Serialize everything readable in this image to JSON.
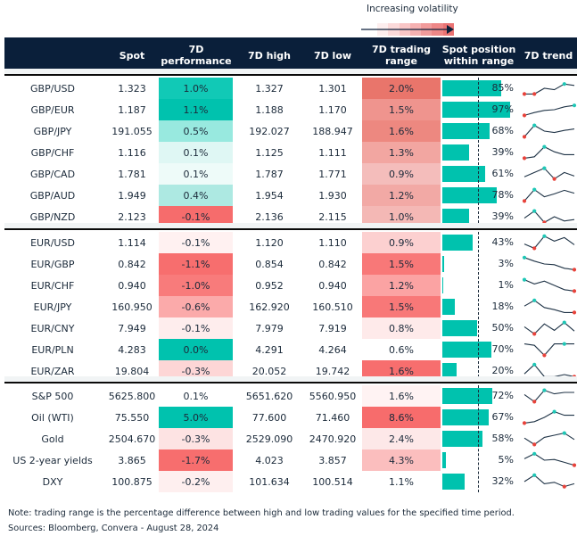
{
  "legend": {
    "label": "Increasing volatility",
    "gradient": [
      "#fdeeee",
      "#fbdada",
      "#f9c6c6",
      "#f5b1b1",
      "#f19b9b",
      "#ee8787",
      "#ea7373"
    ],
    "arrow_color": "#0a1f3a"
  },
  "colors": {
    "header_bg": "#0a1f3a",
    "position_bar": "#00c2ae",
    "trend_line": "#1f3346",
    "trend_high": "#1fc7b6",
    "trend_low": "#e8423a",
    "band": "#f1f4f5"
  },
  "headers": {
    "spot": "Spot",
    "perf": "7D performance",
    "high": "7D high",
    "low": "7D low",
    "range": "7D trading range",
    "position": "Spot position within range",
    "trend": "7D trend"
  },
  "groups": [
    {
      "rows": [
        {
          "name": "GBP/USD",
          "spot": "1.323",
          "perf": "1.0%",
          "high": "1.327",
          "low": "1.301",
          "range": "2.0%",
          "pos": "85%",
          "perf_color": "#11c9b6",
          "range_color": "#e9756b",
          "pos_val": 85,
          "trend": [
            0.1,
            0.1,
            0.5,
            0.4,
            0.8,
            0.7
          ],
          "hi": 4,
          "lo": [
            0,
            1
          ]
        },
        {
          "name": "GBP/EUR",
          "spot": "1.187",
          "perf": "1.1%",
          "high": "1.188",
          "low": "1.170",
          "range": "1.5%",
          "pos": "97%",
          "perf_color": "#00c2ae",
          "range_color": "#ef948e",
          "pos_val": 97,
          "trend": [
            0.1,
            0.3,
            0.45,
            0.5,
            0.7,
            0.8
          ],
          "hi": 5,
          "lo": [
            0
          ]
        },
        {
          "name": "GBP/JPY",
          "spot": "191.055",
          "perf": "0.5%",
          "high": "192.027",
          "low": "188.947",
          "range": "1.6%",
          "pos": "68%",
          "perf_color": "#98e9df",
          "range_color": "#ed8880",
          "pos_val": 68,
          "trend": [
            0.1,
            0.9,
            0.5,
            0.4,
            0.55,
            0.65
          ],
          "hi": 1,
          "lo": [
            0
          ]
        },
        {
          "name": "GBP/CHF",
          "spot": "1.116",
          "perf": "0.1%",
          "high": "1.125",
          "low": "1.111",
          "range": "1.3%",
          "pos": "39%",
          "perf_color": "#dff7f4",
          "range_color": "#f2a6a1",
          "pos_val": 39,
          "trend": [
            0.1,
            0.2,
            0.9,
            0.55,
            0.35,
            0.35
          ],
          "hi": 2,
          "lo": [
            0
          ]
        },
        {
          "name": "GBP/CAD",
          "spot": "1.781",
          "perf": "0.1%",
          "high": "1.787",
          "low": "1.771",
          "range": "0.9%",
          "pos": "61%",
          "perf_color": "#eefbf9",
          "range_color": "#f4bdbb",
          "pos_val": 61,
          "trend": [
            0.3,
            0.6,
            0.9,
            0.15,
            0.6,
            0.35
          ],
          "hi": 2,
          "lo": [
            3
          ]
        },
        {
          "name": "GBP/AUD",
          "spot": "1.949",
          "perf": "0.4%",
          "high": "1.954",
          "low": "1.930",
          "range": "1.2%",
          "pos": "78%",
          "perf_color": "#ade9e2",
          "range_color": "#f2a9a5",
          "pos_val": 78,
          "trend": [
            0.1,
            0.9,
            0.4,
            0.6,
            0.85,
            0.65
          ],
          "hi": 1,
          "lo": [
            0
          ]
        },
        {
          "name": "GBP/NZD",
          "spot": "2.123",
          "perf": "-0.1%",
          "high": "2.136",
          "low": "2.115",
          "range": "1.0%",
          "pos": "39%",
          "perf_color": "#f66c6c",
          "range_color": "#f4b8b5",
          "pos_val": 39,
          "trend": [
            0.4,
            0.9,
            0.1,
            0.5,
            0.2,
            0.3
          ],
          "hi": 1,
          "lo": [
            2
          ]
        }
      ]
    },
    {
      "rows": [
        {
          "name": "EUR/USD",
          "spot": "1.114",
          "perf": "-0.1%",
          "high": "1.120",
          "low": "1.110",
          "range": "0.9%",
          "pos": "43%",
          "perf_color": "#fff1f1",
          "range_color": "#fcd0d0",
          "pos_val": 43,
          "trend": [
            0.4,
            0.1,
            0.95,
            0.6,
            0.85,
            0.35
          ],
          "hi": 2,
          "lo": [
            1
          ]
        },
        {
          "name": "EUR/GBP",
          "spot": "0.842",
          "perf": "-1.1%",
          "high": "0.854",
          "low": "0.842",
          "range": "1.5%",
          "pos": "3%",
          "perf_color": "#f76e6e",
          "range_color": "#f87878",
          "pos_val": 3,
          "trend": [
            0.95,
            0.7,
            0.5,
            0.45,
            0.2,
            0.1
          ],
          "hi": 0,
          "lo": [
            5
          ]
        },
        {
          "name": "EUR/CHF",
          "spot": "0.940",
          "perf": "-1.0%",
          "high": "0.952",
          "low": "0.940",
          "range": "1.2%",
          "pos": "1%",
          "perf_color": "#f87b7b",
          "range_color": "#fba3a3",
          "pos_val": 1,
          "trend": [
            0.9,
            0.6,
            0.8,
            0.5,
            0.2,
            0.1
          ],
          "hi": 0,
          "lo": [
            5
          ]
        },
        {
          "name": "EUR/JPY",
          "spot": "160.950",
          "perf": "-0.6%",
          "high": "162.920",
          "low": "160.510",
          "range": "1.5%",
          "pos": "18%",
          "perf_color": "#fbaaaa",
          "range_color": "#f87878",
          "pos_val": 18,
          "trend": [
            0.55,
            0.95,
            0.45,
            0.3,
            0.1,
            0.1
          ],
          "hi": 1,
          "lo": [
            5
          ]
        },
        {
          "name": "EUR/CNY",
          "spot": "7.949",
          "perf": "-0.1%",
          "high": "7.979",
          "low": "7.919",
          "range": "0.8%",
          "pos": "50%",
          "perf_color": "#feeded",
          "range_color": "#feeaea",
          "pos_val": 50,
          "trend": [
            0.6,
            0.1,
            0.8,
            0.35,
            0.9,
            0.3
          ],
          "hi": 4,
          "lo": [
            1
          ]
        },
        {
          "name": "EUR/PLN",
          "spot": "4.283",
          "perf": "0.0%",
          "high": "4.291",
          "low": "4.264",
          "range": "0.6%",
          "pos": "70%",
          "perf_color": "#00c2ae",
          "range_color": "#ffffff",
          "pos_val": 70,
          "trend": [
            0.9,
            0.8,
            0.1,
            0.9,
            0.9,
            0.9
          ],
          "hi": 4,
          "lo": [
            2
          ]
        },
        {
          "name": "EUR/ZAR",
          "spot": "19.804",
          "perf": "-0.3%",
          "high": "20.052",
          "low": "19.742",
          "range": "1.6%",
          "pos": "20%",
          "perf_color": "#fdd6d6",
          "range_color": "#f76e6e",
          "pos_val": 20,
          "trend": [
            0.3,
            0.95,
            0.1,
            0.1,
            0.25,
            0.1
          ],
          "hi": 1,
          "lo": [
            5
          ]
        }
      ]
    },
    {
      "rows": [
        {
          "name": "S&P 500",
          "spot": "5625.800",
          "perf": "0.1%",
          "high": "5651.620",
          "low": "5560.950",
          "range": "1.6%",
          "pos": "72%",
          "perf_color": "#ffffff",
          "range_color": "#fff3f3",
          "pos_val": 72,
          "trend": [
            0.6,
            0.1,
            0.9,
            0.65,
            0.75,
            0.75
          ],
          "hi": 2,
          "lo": [
            1
          ]
        },
        {
          "name": "Oil (WTI)",
          "spot": "75.550",
          "perf": "5.0%",
          "high": "77.600",
          "low": "71.460",
          "range": "8.6%",
          "pos": "67%",
          "perf_color": "#00c2ae",
          "range_color": "#f76c6c",
          "pos_val": 67,
          "trend": [
            0.1,
            0.2,
            0.5,
            0.9,
            0.65,
            0.65
          ],
          "hi": 3,
          "lo": [
            0
          ]
        },
        {
          "name": "Gold",
          "spot": "2504.670",
          "perf": "-0.3%",
          "high": "2529.090",
          "low": "2470.920",
          "range": "2.4%",
          "pos": "58%",
          "perf_color": "#fde3e3",
          "range_color": "#fde8e8",
          "pos_val": 58,
          "trend": [
            0.55,
            0.1,
            0.6,
            0.75,
            0.9,
            0.45
          ],
          "hi": 4,
          "lo": [
            1
          ]
        },
        {
          "name": "US 2-year yields",
          "spot": "3.865",
          "perf": "-1.7%",
          "high": "4.023",
          "low": "3.857",
          "range": "4.3%",
          "pos": "5%",
          "perf_color": "#f76e6e",
          "range_color": "#fbbebe",
          "pos_val": 5,
          "trend": [
            0.6,
            0.95,
            0.5,
            0.55,
            0.35,
            0.15
          ],
          "hi": 1,
          "lo": [
            5
          ]
        },
        {
          "name": "DXY",
          "spot": "100.875",
          "perf": "-0.2%",
          "high": "101.634",
          "low": "100.514",
          "range": "1.1%",
          "pos": "32%",
          "perf_color": "#feefef",
          "range_color": "#ffffff",
          "pos_val": 32,
          "trend": [
            0.5,
            0.95,
            0.35,
            0.45,
            0.15,
            0.35
          ],
          "hi": 1,
          "lo": [
            4
          ]
        }
      ]
    }
  ],
  "notes": {
    "note": "Note: trading range is the percentage difference between high and low trading values for the specified time period.",
    "sources": "Sources: Bloomberg, Convera - August 28, 2024"
  },
  "chart_data": {
    "type": "table",
    "title": "",
    "columns": [
      "",
      "Spot",
      "7D performance",
      "7D high",
      "7D low",
      "7D trading range",
      "Spot position within range",
      "7D trend"
    ],
    "rows": [
      [
        "GBP/USD",
        "1.323",
        "1.0%",
        "1.327",
        "1.301",
        "2.0%",
        "85%"
      ],
      [
        "GBP/EUR",
        "1.187",
        "1.1%",
        "1.188",
        "1.170",
        "1.5%",
        "97%"
      ],
      [
        "GBP/JPY",
        "191.055",
        "0.5%",
        "192.027",
        "188.947",
        "1.6%",
        "68%"
      ],
      [
        "GBP/CHF",
        "1.116",
        "0.1%",
        "1.125",
        "1.111",
        "1.3%",
        "39%"
      ],
      [
        "GBP/CAD",
        "1.781",
        "0.1%",
        "1.787",
        "1.771",
        "0.9%",
        "61%"
      ],
      [
        "GBP/AUD",
        "1.949",
        "0.4%",
        "1.954",
        "1.930",
        "1.2%",
        "78%"
      ],
      [
        "GBP/NZD",
        "2.123",
        "-0.1%",
        "2.136",
        "2.115",
        "1.0%",
        "39%"
      ],
      [
        "EUR/USD",
        "1.114",
        "-0.1%",
        "1.120",
        "1.110",
        "0.9%",
        "43%"
      ],
      [
        "EUR/GBP",
        "0.842",
        "-1.1%",
        "0.854",
        "0.842",
        "1.5%",
        "3%"
      ],
      [
        "EUR/CHF",
        "0.940",
        "-1.0%",
        "0.952",
        "0.940",
        "1.2%",
        "1%"
      ],
      [
        "EUR/JPY",
        "160.950",
        "-0.6%",
        "162.920",
        "160.510",
        "1.5%",
        "18%"
      ],
      [
        "EUR/CNY",
        "7.949",
        "-0.1%",
        "7.979",
        "7.919",
        "0.8%",
        "50%"
      ],
      [
        "EUR/PLN",
        "4.283",
        "0.0%",
        "4.291",
        "4.264",
        "0.6%",
        "70%"
      ],
      [
        "EUR/ZAR",
        "19.804",
        "-0.3%",
        "20.052",
        "19.742",
        "1.6%",
        "20%"
      ],
      [
        "S&P 500",
        "5625.800",
        "0.1%",
        "5651.620",
        "5560.950",
        "1.6%",
        "72%"
      ],
      [
        "Oil (WTI)",
        "75.550",
        "5.0%",
        "77.600",
        "71.460",
        "8.6%",
        "67%"
      ],
      [
        "Gold",
        "2504.670",
        "-0.3%",
        "2529.090",
        "2470.920",
        "2.4%",
        "58%"
      ],
      [
        "US 2-year yields",
        "3.865",
        "-1.7%",
        "4.023",
        "3.857",
        "4.3%",
        "5%"
      ],
      [
        "DXY",
        "100.875",
        "-0.2%",
        "101.634",
        "100.514",
        "1.1%",
        "32%"
      ]
    ],
    "position_reference": 0.5,
    "legend_text": "Increasing volatility"
  }
}
